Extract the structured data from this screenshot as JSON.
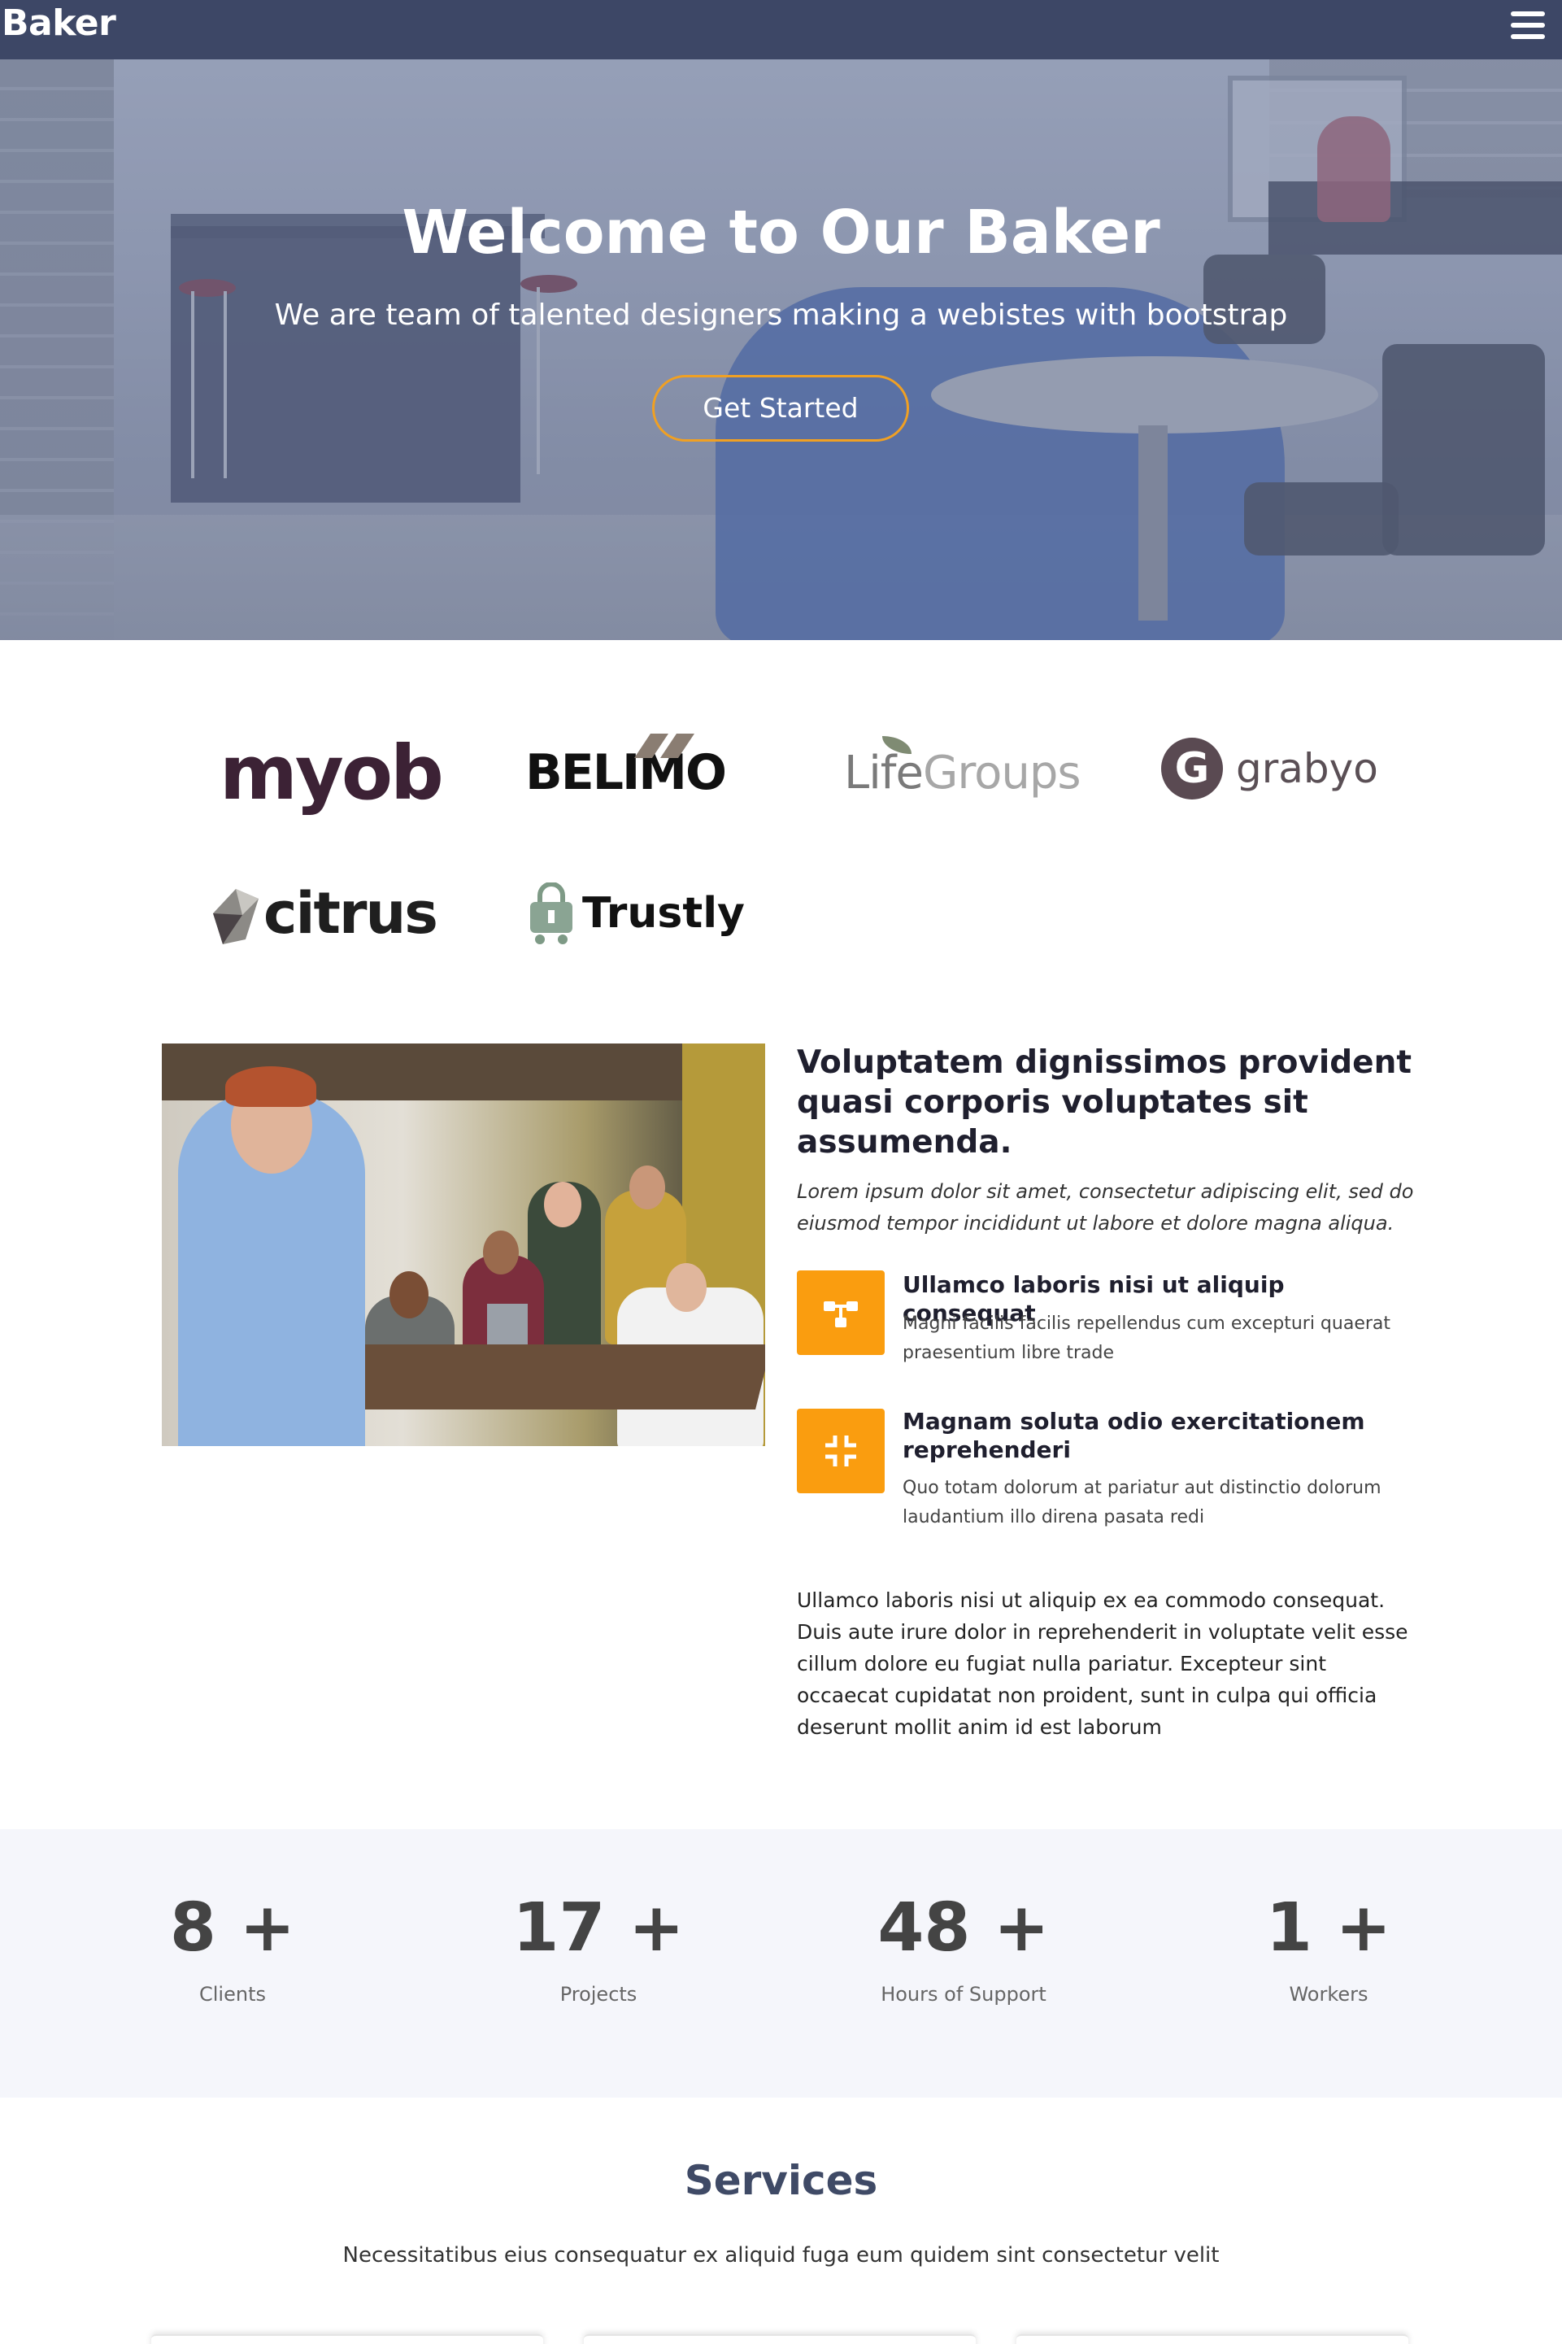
{
  "nav": {
    "brand": "Baker",
    "menu_icon": "hamburger-icon"
  },
  "hero": {
    "title": "Welcome to Our Baker",
    "subtitle": "We are team of talented designers making a webistes with bootstrap",
    "cta_label": "Get Started",
    "accent_color": "#f0a023"
  },
  "clients": {
    "myob": "myob",
    "belimo": "BELIMO",
    "life_a": "Life",
    "life_b": "Groups",
    "grabyo_mark": "G",
    "grabyo": "grabyo",
    "citrus": "citrus",
    "trustly": "Trustly"
  },
  "about": {
    "title": "Voluptatem dignissimos provident quasi corporis voluptates sit assumenda.",
    "lead": "Lorem ipsum dolor sit amet, consectetur adipiscing elit, sed do eiusmod tempor incididunt ut labore et dolore magna aliqua.",
    "features": [
      {
        "icon": "share-nodes-icon",
        "title": "Ullamco laboris nisi ut aliquip consequat",
        "desc": "Magni facilis facilis repellendus cum excepturi quaerat praesentium libre trade"
      },
      {
        "icon": "compress-icon",
        "title": "Magnam soluta odio exercitationem reprehenderi",
        "desc": "Quo totam dolorum at pariatur aut distinctio dolorum laudantium illo direna pasata redi"
      }
    ],
    "body": "Ullamco laboris nisi ut aliquip ex ea commodo consequat. Duis aute irure dolor in reprehenderit in voluptate velit esse cillum dolore eu fugiat nulla pariatur. Excepteur sint occaecat cupidatat non proident, sunt in culpa qui officia deserunt mollit anim id est laborum",
    "icon_color": "#fa9d0f"
  },
  "counts": [
    {
      "value": "8 +",
      "label": "Clients"
    },
    {
      "value": "17 +",
      "label": "Projects"
    },
    {
      "value": "48 +",
      "label": "Hours of Support"
    },
    {
      "value": "1 +",
      "label": "Workers"
    }
  ],
  "services": {
    "title": "Services",
    "subtitle": "Necessitatibus eius consequatur ex aliquid fuga eum quidem sint consectetur velit"
  }
}
